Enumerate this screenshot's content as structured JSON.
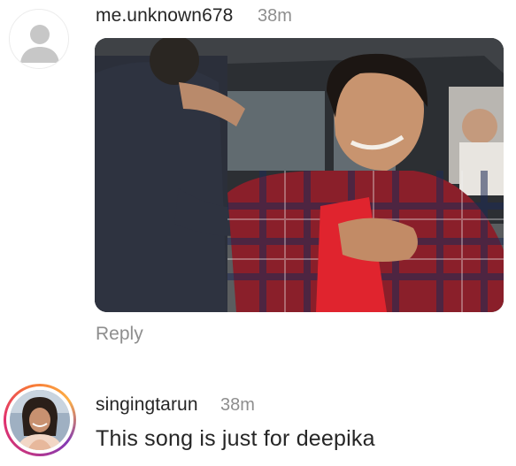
{
  "comments": [
    {
      "username": "me.unknown678",
      "time": "38m",
      "avatar": "default-avatar-icon",
      "media": "gif",
      "reply_label": "Reply"
    },
    {
      "username": "singingtarun",
      "time": "38m",
      "avatar": "profile-photo",
      "text": "This song is just for deepika"
    }
  ],
  "colors": {
    "text_primary": "#262626",
    "text_secondary": "#8e8e8e",
    "story_ring_start": "#c13584",
    "story_ring_end": "#fcaf45"
  }
}
